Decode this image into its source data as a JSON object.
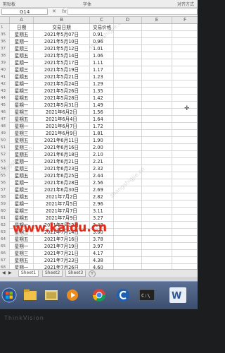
{
  "ribbon": {
    "clipboard_label": "剪贴板",
    "font_label": "字体",
    "align_label": "对齐方式"
  },
  "formula_bar": {
    "name_box": "G14",
    "fx": "fx",
    "value": ""
  },
  "columns": [
    "A",
    "B",
    "C",
    "D",
    "E",
    "F"
  ],
  "table": {
    "headers": {
      "row_number": "1",
      "a": "日期",
      "b": "交易日期",
      "c": "交易价格"
    },
    "rows": [
      {
        "n": "35",
        "a": "星期五",
        "b": "2021年5月07日",
        "c": "0.91"
      },
      {
        "n": "36",
        "a": "星期一",
        "b": "2021年5月10日",
        "c": "0.96"
      },
      {
        "n": "37",
        "a": "星期三",
        "b": "2021年5月12日",
        "c": "1.01"
      },
      {
        "n": "38",
        "a": "星期五",
        "b": "2021年5月14日",
        "c": "1.06"
      },
      {
        "n": "39",
        "a": "星期一",
        "b": "2021年5月17日",
        "c": "1.11"
      },
      {
        "n": "40",
        "a": "星期三",
        "b": "2021年5月19日",
        "c": "1.17"
      },
      {
        "n": "41",
        "a": "星期五",
        "b": "2021年5月21日",
        "c": "1.23"
      },
      {
        "n": "42",
        "a": "星期一",
        "b": "2021年5月24日",
        "c": "1.29"
      },
      {
        "n": "43",
        "a": "星期三",
        "b": "2021年5月26日",
        "c": "1.35"
      },
      {
        "n": "44",
        "a": "星期五",
        "b": "2021年5月28日",
        "c": "1.42"
      },
      {
        "n": "45",
        "a": "星期一",
        "b": "2021年5月31日",
        "c": "1.49"
      },
      {
        "n": "46",
        "a": "星期三",
        "b": "2021年6月2日",
        "c": "1.56"
      },
      {
        "n": "47",
        "a": "星期五",
        "b": "2021年6月4日",
        "c": "1.64"
      },
      {
        "n": "48",
        "a": "星期一",
        "b": "2021年6月7日",
        "c": "1.72"
      },
      {
        "n": "49",
        "a": "星期三",
        "b": "2021年6月9日",
        "c": "1.81"
      },
      {
        "n": "50",
        "a": "星期五",
        "b": "2021年6月11日",
        "c": "1.90"
      },
      {
        "n": "51",
        "a": "星期三",
        "b": "2021年6月16日",
        "c": "2.00"
      },
      {
        "n": "52",
        "a": "星期五",
        "b": "2021年6月18日",
        "c": "2.10"
      },
      {
        "n": "53",
        "a": "星期一",
        "b": "2021年6月21日",
        "c": "2.21"
      },
      {
        "n": "54",
        "a": "星期三",
        "b": "2021年6月23日",
        "c": "2.32"
      },
      {
        "n": "55",
        "a": "星期五",
        "b": "2021年6月25日",
        "c": "2.44"
      },
      {
        "n": "56",
        "a": "星期一",
        "b": "2021年6月28日",
        "c": "2.56"
      },
      {
        "n": "57",
        "a": "星期三",
        "b": "2021年6月30日",
        "c": "2.69"
      },
      {
        "n": "58",
        "a": "星期五",
        "b": "2021年7月2日",
        "c": "2.82"
      },
      {
        "n": "59",
        "a": "星期一",
        "b": "2021年7月5日",
        "c": "2.96"
      },
      {
        "n": "60",
        "a": "星期三",
        "b": "2021年7月7日",
        "c": "3.11"
      },
      {
        "n": "61",
        "a": "星期五",
        "b": "2021年7月9日",
        "c": "3.27"
      },
      {
        "n": "62",
        "a": "星期一",
        "b": "2021年7月12日",
        "c": "3.43"
      },
      {
        "n": "63",
        "a": "星期三",
        "b": "2021年7月14日",
        "c": "3.60"
      },
      {
        "n": "64",
        "a": "星期五",
        "b": "2021年7月16日",
        "c": "3.78"
      },
      {
        "n": "65",
        "a": "星期一",
        "b": "2021年7月19日",
        "c": "3.97"
      },
      {
        "n": "66",
        "a": "星期三",
        "b": "2021年7月21日",
        "c": "4.17"
      },
      {
        "n": "67",
        "a": "星期五",
        "b": "2021年7月23日",
        "c": "4.38"
      },
      {
        "n": "68",
        "a": "星期一",
        "b": "2021年7月26日",
        "c": "4.60"
      }
    ]
  },
  "sheet_tabs": [
    "Sheet1",
    "Sheet2",
    "Sheet3"
  ],
  "add_sheet": "+",
  "watermark": "www.kaidu.cn",
  "ghost_watermark": "shangshigjie.cn",
  "bezel": "ThinkVision",
  "taskbar": {
    "icons": [
      "windows-start",
      "explorer",
      "file-manager",
      "media-player",
      "chrome",
      "browser-c",
      "terminal",
      "wps-writer"
    ],
    "accent": "#4a638b"
  }
}
